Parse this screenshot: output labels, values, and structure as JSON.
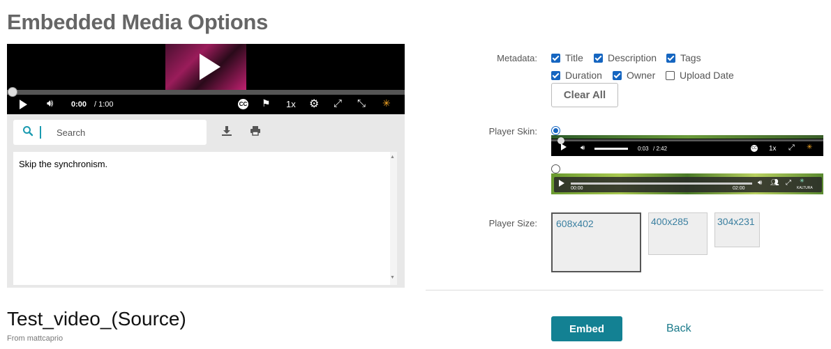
{
  "page": {
    "title": "Embedded Media Options"
  },
  "player": {
    "time_current": "0:00",
    "time_duration": "/ 1:00",
    "speed": "1x",
    "cc_label": "CC"
  },
  "transcript": {
    "search_placeholder": "Search",
    "text": "Skip the synchronism."
  },
  "video": {
    "title": "Test_video_(Source)",
    "owner": "From mattcaprio"
  },
  "metadata": {
    "label": "Metadata:",
    "options": [
      {
        "label": "Title",
        "checked": true
      },
      {
        "label": "Description",
        "checked": true
      },
      {
        "label": "Tags",
        "checked": true
      },
      {
        "label": "Duration",
        "checked": true
      },
      {
        "label": "Owner",
        "checked": true
      },
      {
        "label": "Upload Date",
        "checked": false
      }
    ],
    "clear_all_label": "Clear All"
  },
  "player_skin": {
    "label": "Player Skin:",
    "selected": 0,
    "skin1": {
      "time_current": "0:03",
      "time_duration": "/ 2:42",
      "speed": "1x"
    },
    "skin2": {
      "time_start": "00:00",
      "time_end": "02:00",
      "brand": "KALTURA"
    }
  },
  "player_size": {
    "label": "Player Size:",
    "options": [
      "608x402",
      "400x285",
      "304x231"
    ],
    "selected": 0
  },
  "actions": {
    "embed_label": "Embed",
    "back_label": "Back"
  },
  "colors": {
    "accent": "#138193",
    "checkbox": "#1565c0",
    "link": "#1a7a8a"
  }
}
